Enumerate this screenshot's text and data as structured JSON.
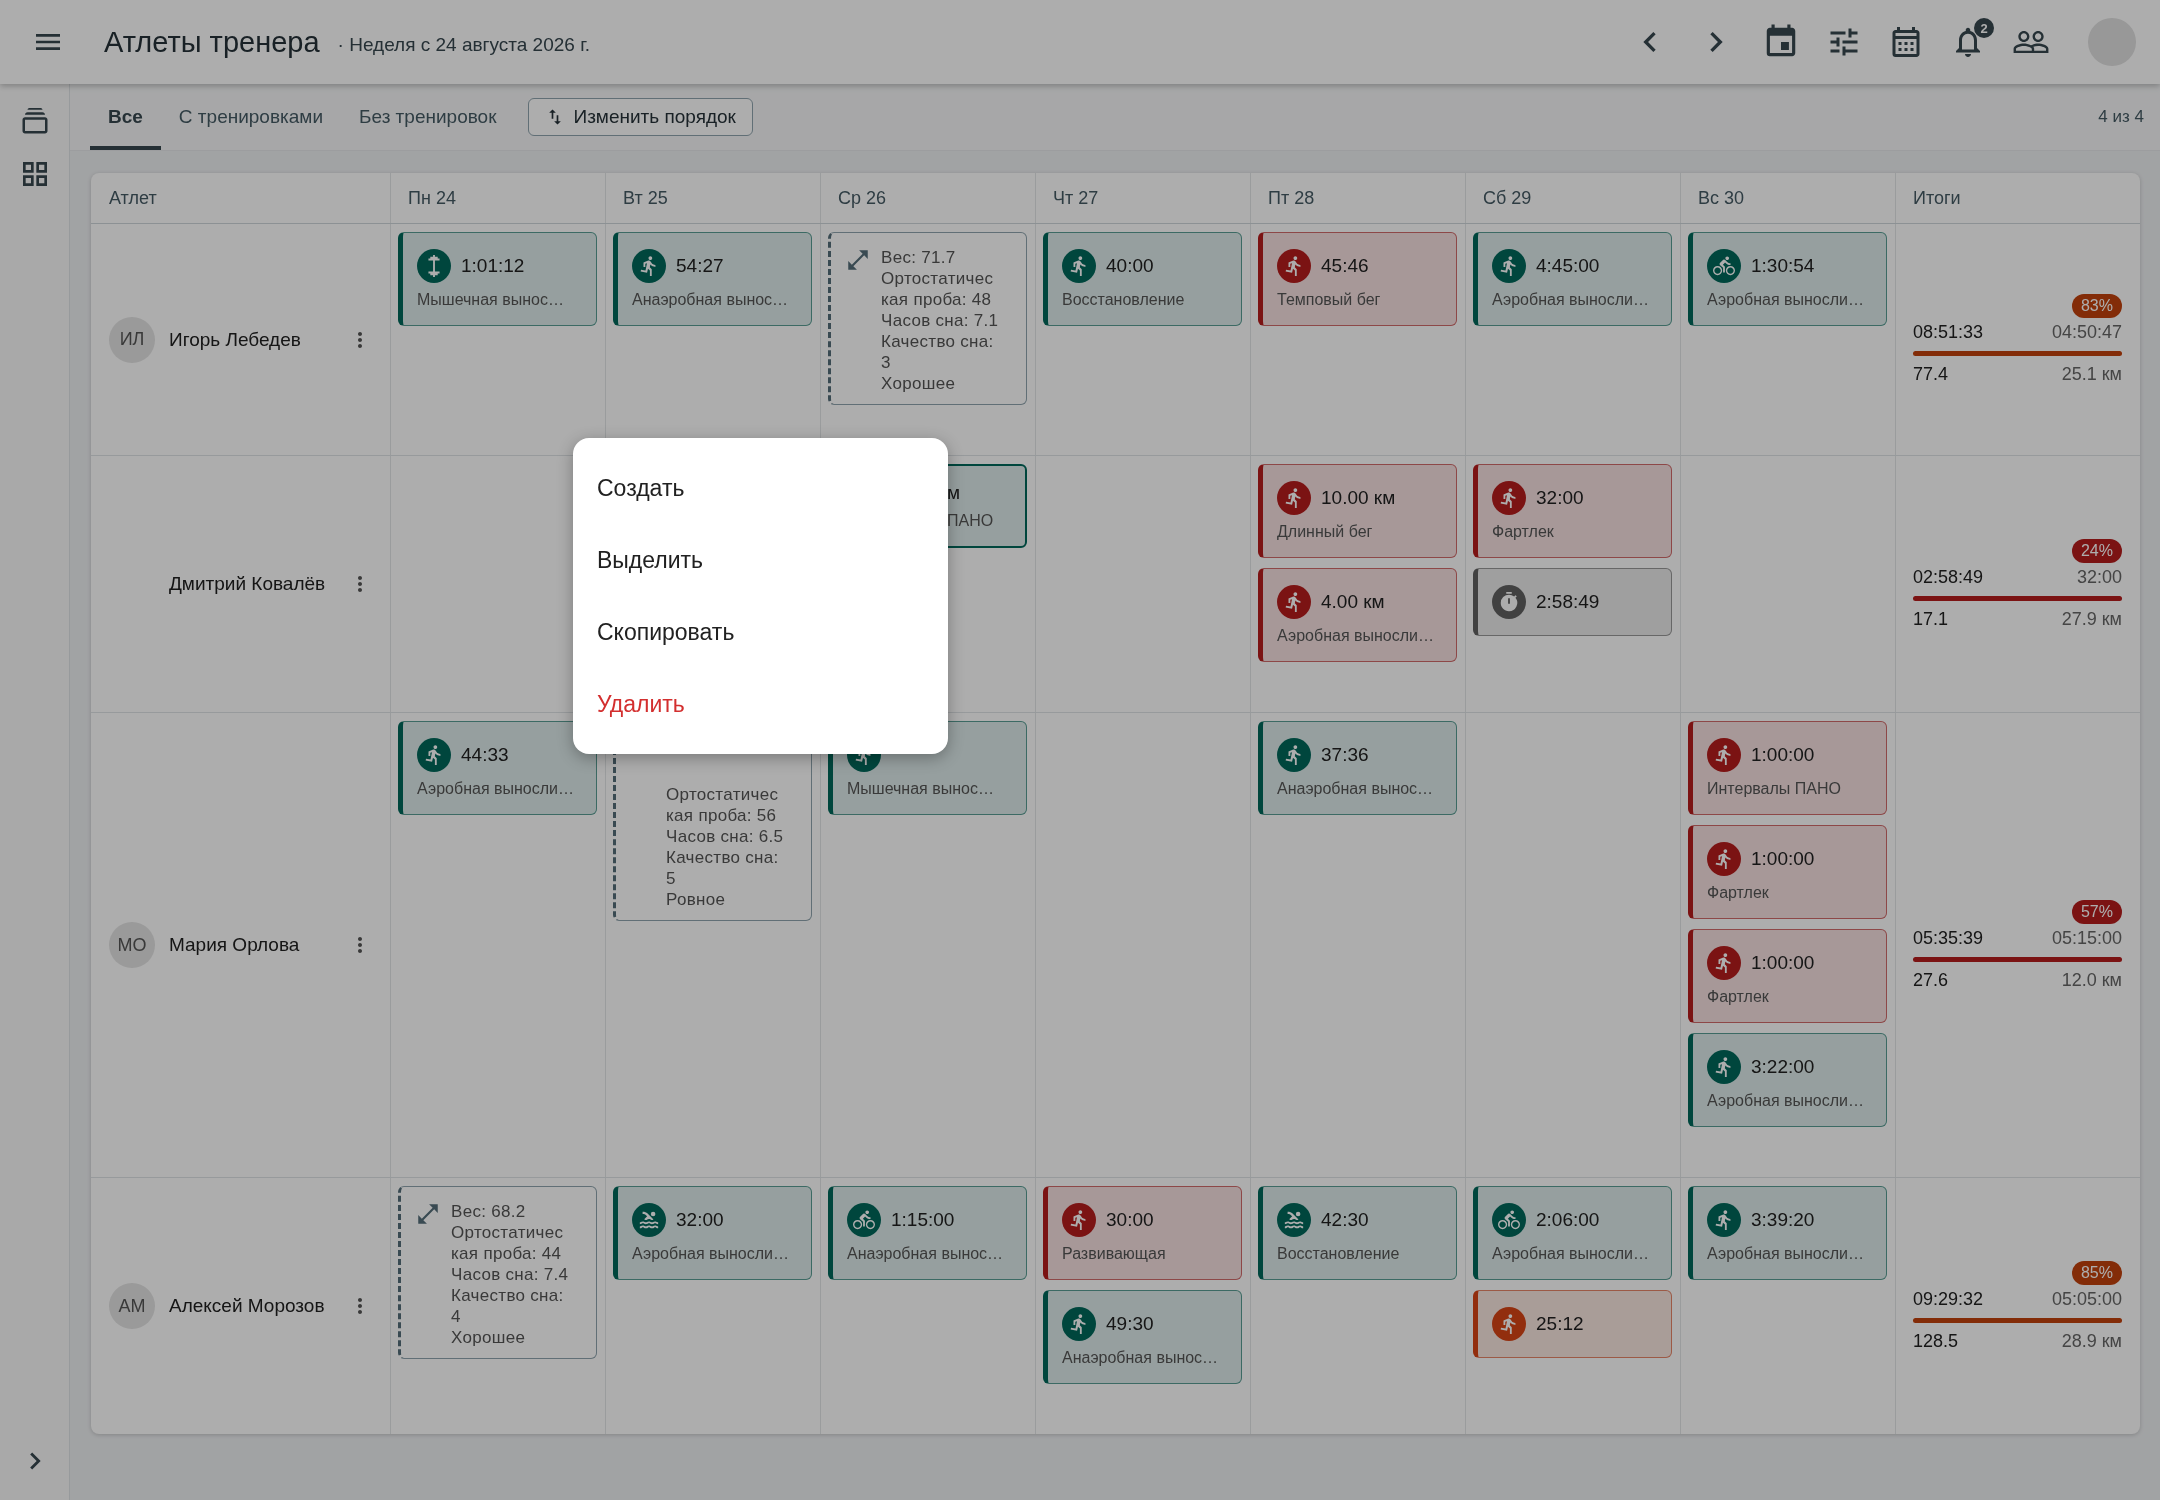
{
  "header": {
    "title": "Атлеты тренера",
    "subtitle": "· Неделя с 24 августа 2026 г.",
    "notifications": "2"
  },
  "tabs": [
    {
      "label": "Все",
      "selected": true
    },
    {
      "label": "С тренировками",
      "selected": false
    },
    {
      "label": "Без тренировок",
      "selected": false
    }
  ],
  "reorder_button": "Изменить порядок",
  "count": "4 из 4",
  "table": {
    "columns": [
      "Атлет",
      "Пн 24",
      "Вт 25",
      "Ср 26",
      "Чт 27",
      "Пт 28",
      "Сб 29",
      "Вс 30",
      "Итоги"
    ],
    "rows": [
      {
        "initials": "ИЛ",
        "name": "Игорь Лебедев",
        "days": {
          "mon": [
            {
              "kind": "strength",
              "color": "#00473e",
              "value": "1:01:12",
              "label": "Мышечная вынос…"
            }
          ],
          "tue": [
            {
              "kind": "run",
              "color": "#00473e",
              "value": "54:27",
              "label": "Анаэробная вынос…"
            }
          ],
          "wed": [
            {
              "kind": "metric",
              "lines": [
                "Вес: 71.7",
                "Ортостатичес",
                "кая проба: 48",
                "Часов сна: 7.1",
                "Качество сна:",
                "3",
                "Хорошее"
              ]
            }
          ],
          "thu": [
            {
              "kind": "run",
              "color": "#00473e",
              "value": "40:00",
              "label": "Восстановление"
            }
          ],
          "fri": [
            {
              "kind": "run",
              "color": "#7c1313",
              "value": "45:46",
              "label": "Темповый бег"
            }
          ],
          "sat": [
            {
              "kind": "run",
              "color": "#00473e",
              "value": "4:45:00",
              "label": "Аэробная выносли…"
            }
          ],
          "sun": [
            {
              "kind": "bike",
              "color": "#00473e",
              "value": "1:30:54",
              "label": "Аэробная выносли…"
            }
          ]
        },
        "totals": {
          "badge": "83%",
          "color": "#842c08",
          "time": "08:51:33",
          "planned_time": "04:50:47",
          "distance": "77.4",
          "planned_distance": "25.1 км"
        }
      },
      {
        "name": "Дмитрий Ковалёв",
        "days": {
          "wed": [
            {
              "kind": "run",
              "color": "#00473e",
              "covered": true,
              "value": "м",
              "label": "ПАНО"
            }
          ],
          "fri": [
            {
              "kind": "run",
              "color": "#7c1313",
              "value": "10.00 км",
              "label": "Длинный бег"
            },
            {
              "kind": "run",
              "color": "#7c1313",
              "value": "4.00 км",
              "label": "Аэробная выносли…"
            }
          ],
          "sat": [
            {
              "kind": "run",
              "color": "#7c1313",
              "value": "32:00",
              "label": "Фартлек"
            },
            {
              "kind": "timer",
              "color": "#424242",
              "value": "2:58:49"
            }
          ]
        },
        "totals": {
          "badge": "24%",
          "color": "#7c1313",
          "time": "02:58:49",
          "planned_time": "32:00",
          "distance": "17.1",
          "planned_distance": "27.9 км"
        }
      },
      {
        "initials": "МО",
        "name": "Мария Орлова",
        "days": {
          "mon": [
            {
              "kind": "run",
              "color": "#00473e",
              "value": "44:33",
              "label": "Аэробная выносли…"
            }
          ],
          "tue": [
            {
              "kind": "metric",
              "covered": true,
              "lines": [
                "Ортостатичес",
                "кая проба: 56",
                "Часов сна: 6.5",
                "Качество сна:",
                "5",
                "Ровное"
              ]
            }
          ],
          "wed": [
            {
              "kind": "run",
              "color": "#00473e",
              "label": "Мышечная вынос…"
            }
          ],
          "fri": [
            {
              "kind": "run",
              "color": "#00473e",
              "value": "37:36",
              "label": "Анаэробная вынос…"
            }
          ],
          "sun": [
            {
              "kind": "run",
              "color": "#7c1313",
              "value": "1:00:00",
              "label": "Интервалы ПАНО"
            },
            {
              "kind": "run",
              "color": "#7c1313",
              "value": "1:00:00",
              "label": "Фартлек"
            },
            {
              "kind": "run",
              "color": "#7c1313",
              "value": "1:00:00",
              "label": "Фартлек"
            },
            {
              "kind": "run",
              "color": "#00473e",
              "value": "3:22:00",
              "label": "Аэробная выносли…"
            }
          ]
        },
        "totals": {
          "badge": "57%",
          "color": "#7c1313",
          "time": "05:35:39",
          "planned_time": "05:15:00",
          "distance": "27.6",
          "planned_distance": "12.0 км"
        }
      },
      {
        "initials": "АМ",
        "name": "Алексей Морозов",
        "days": {
          "mon": [
            {
              "kind": "metric",
              "lines": [
                "Вес: 68.2",
                "Ортостатичес",
                "кая проба: 44",
                "Часов сна: 7.4",
                "Качество сна:",
                "4",
                "Хорошее"
              ]
            }
          ],
          "tue": [
            {
              "kind": "swim",
              "color": "#00473e",
              "value": "32:00",
              "label": "Аэробная выносли…"
            }
          ],
          "wed": [
            {
              "kind": "bike",
              "color": "#00473e",
              "value": "1:15:00",
              "label": "Анаэробная вынос…"
            }
          ],
          "thu": [
            {
              "kind": "run",
              "color": "#7c1313",
              "value": "30:00",
              "label": "Развивающая"
            },
            {
              "kind": "run",
              "color": "#00473e",
              "value": "49:30",
              "label": "Анаэробная вынос…"
            }
          ],
          "fri": [
            {
              "kind": "swim",
              "color": "#00473e",
              "value": "42:30",
              "label": "Восстановление"
            }
          ],
          "sat": [
            {
              "kind": "bike",
              "color": "#00473e",
              "value": "2:06:00",
              "label": "Аэробная выносли…"
            },
            {
              "kind": "run",
              "color": "#932e0e",
              "value": "25:12"
            }
          ],
          "sun": [
            {
              "kind": "run",
              "color": "#00473e",
              "value": "3:39:20",
              "label": "Аэробная выносли…"
            }
          ]
        },
        "totals": {
          "badge": "85%",
          "color": "#842c08",
          "time": "09:29:32",
          "planned_time": "05:05:00",
          "distance": "128.5",
          "planned_distance": "28.9 км"
        }
      }
    ]
  },
  "context_menu": {
    "items": [
      {
        "label": "Создать",
        "kind": "normal"
      },
      {
        "label": "Выделить",
        "kind": "normal"
      },
      {
        "label": "Скопировать",
        "kind": "normal"
      },
      {
        "label": "Удалить",
        "kind": "danger"
      }
    ]
  }
}
